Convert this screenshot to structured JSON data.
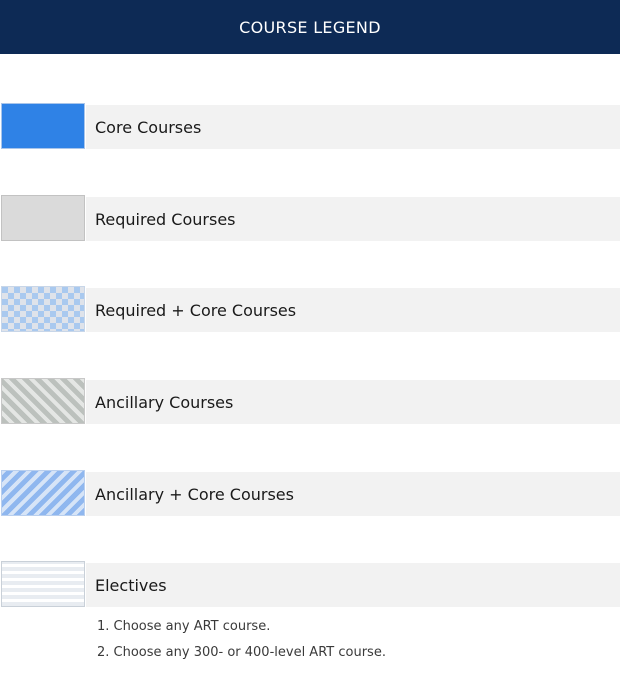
{
  "header": {
    "title": "COURSE LEGEND"
  },
  "legend": {
    "items": [
      {
        "label": "Core Courses",
        "swatch": "solid-blue",
        "color": "#2f82e6"
      },
      {
        "label": "Required Courses",
        "swatch": "solid-gray",
        "color": "#dadada"
      },
      {
        "label": "Required + Core Courses",
        "swatch": "checkered-blue-gray",
        "color": "#a9c9ef"
      },
      {
        "label": "Ancillary Courses",
        "swatch": "diagonal-stripes-gray",
        "color": "#bcc1bd"
      },
      {
        "label": "Ancillary + Core Courses",
        "swatch": "diagonal-stripes-blue",
        "color": "#8fb7ef"
      },
      {
        "label": "Electives",
        "swatch": "horizontal-lines-light",
        "color": "#e8ecf1"
      }
    ]
  },
  "notes": [
    "1. Choose any ART course.",
    "2. Choose any 300- or 400-level ART course."
  ],
  "colors": {
    "header_bg": "#0d2a55",
    "label_bg": "#f2f2f2"
  }
}
